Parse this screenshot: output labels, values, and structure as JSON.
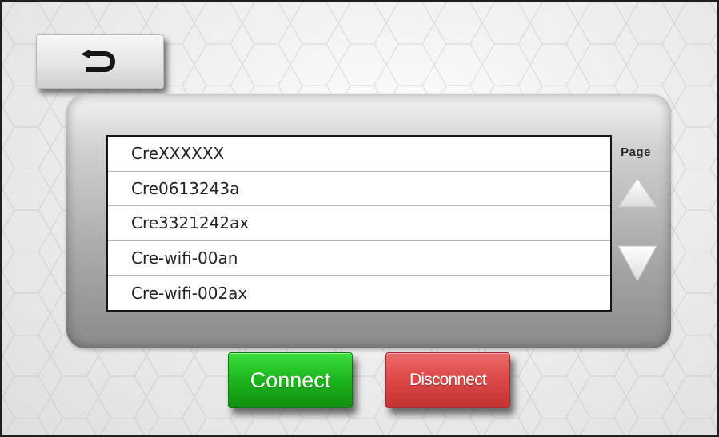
{
  "header": {
    "back_icon": "return-arrow-icon"
  },
  "wifi_list": {
    "items": [
      {
        "ssid": "CreXXXXXX"
      },
      {
        "ssid": "Cre0613243a"
      },
      {
        "ssid": "Cre3321242ax"
      },
      {
        "ssid": "Cre-wifi-00an"
      },
      {
        "ssid": "Cre-wifi-002ax"
      }
    ]
  },
  "pagination": {
    "label": "Page",
    "up_icon": "triangle-up-icon",
    "down_icon": "triangle-down-icon"
  },
  "actions": {
    "connect_label": "Connect",
    "disconnect_label": "Disconnect"
  },
  "colors": {
    "connect": "#1fb91f",
    "disconnect": "#dd4a4a",
    "panel": "#aaaaaa",
    "background": "#f1f1f1"
  }
}
